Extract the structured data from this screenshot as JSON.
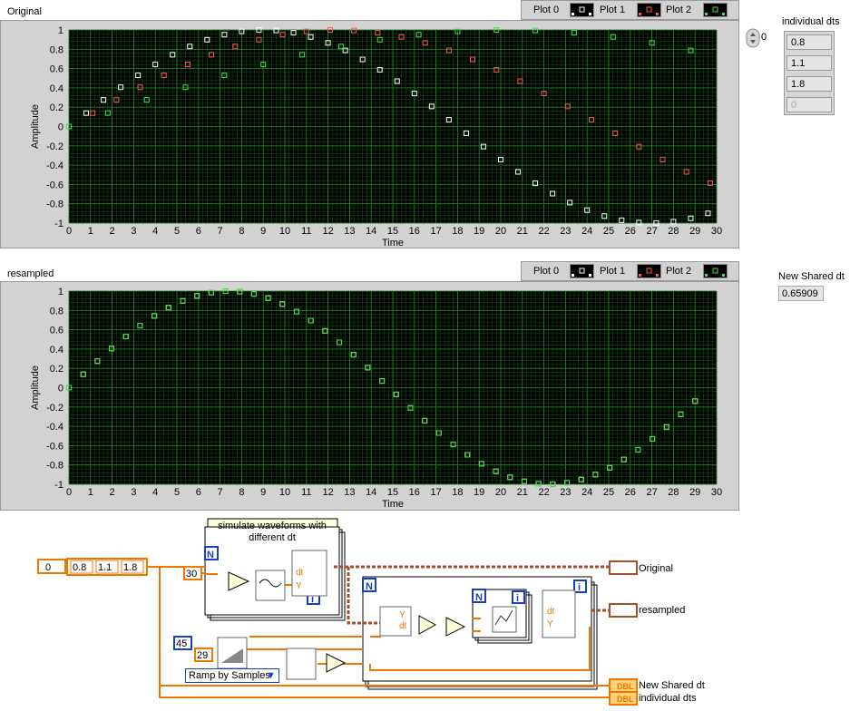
{
  "colors": {
    "plot0": "#ffffff",
    "plot1": "#ff5a4a",
    "plot2": "#3fe04f",
    "grid_major": "#1f8a1f",
    "grid_minor": "#0e4a0e",
    "plot_bg": "#000000",
    "wire_orange": "#f07800",
    "wire_brown": "#a0522d",
    "node_blue": "#1a3fbf"
  },
  "graph_original": {
    "title": "Original",
    "legend": [
      "Plot 0",
      "Plot 1",
      "Plot 2"
    ],
    "xlabel": "Time",
    "ylabel": "Amplitude",
    "xticks": [
      "0",
      "1",
      "2",
      "3",
      "4",
      "5",
      "6",
      "7",
      "8",
      "9",
      "10",
      "11",
      "12",
      "13",
      "14",
      "15",
      "16",
      "17",
      "18",
      "19",
      "20",
      "21",
      "22",
      "23",
      "24",
      "25",
      "26",
      "27",
      "28",
      "29",
      "30"
    ],
    "yticks": [
      "1",
      "0.8",
      "0.6",
      "0.4",
      "0.2",
      "0",
      "-0.2",
      "-0.4",
      "-0.6",
      "-0.8",
      "-1"
    ]
  },
  "graph_resampled": {
    "title": "resampled",
    "legend": [
      "Plot 0",
      "Plot 1",
      "Plot 2"
    ],
    "xlabel": "Time",
    "ylabel": "Amplitude",
    "xticks": [
      "0",
      "1",
      "2",
      "3",
      "4",
      "5",
      "6",
      "7",
      "8",
      "9",
      "10",
      "11",
      "12",
      "13",
      "14",
      "15",
      "16",
      "17",
      "18",
      "19",
      "20",
      "21",
      "22",
      "23",
      "24",
      "25",
      "26",
      "27",
      "28",
      "29",
      "30"
    ],
    "yticks": [
      "1",
      "0.8",
      "0.6",
      "0.4",
      "0.2",
      "0",
      "-0.2",
      "-0.4",
      "-0.6",
      "-0.8",
      "-1"
    ]
  },
  "chart_data": [
    {
      "type": "scatter",
      "title": "Original",
      "xlabel": "Time",
      "ylabel": "Amplitude",
      "xlim": [
        0,
        30
      ],
      "ylim": [
        -1,
        1
      ],
      "grid": true,
      "legend_position": "top-right",
      "series": [
        {
          "name": "Plot 0",
          "dt": 0.8,
          "samples": 38,
          "periods": 45
        },
        {
          "name": "Plot 1",
          "dt": 1.1,
          "samples": 38,
          "periods": 45
        },
        {
          "name": "Plot 2",
          "dt": 1.8,
          "samples": 17,
          "periods": 45
        }
      ]
    },
    {
      "type": "scatter",
      "title": "resampled",
      "xlabel": "Time",
      "ylabel": "Amplitude",
      "xlim": [
        0,
        30
      ],
      "ylim": [
        -1,
        1
      ],
      "grid": true,
      "legend_position": "top-right",
      "series": [
        {
          "name": "Plot 0",
          "dt": 0.65909,
          "samples": 45,
          "periods": 45
        },
        {
          "name": "Plot 1",
          "dt": 0.65909,
          "samples": 45,
          "periods": 45
        },
        {
          "name": "Plot 2",
          "dt": 0.65909,
          "samples": 45,
          "periods": 45
        }
      ]
    }
  ],
  "individual_dts": {
    "label": "individual dts",
    "index": "0",
    "values": [
      "0.8",
      "1.1",
      "1.8",
      "0"
    ]
  },
  "new_shared_dt": {
    "label": "New Shared dt",
    "value": "0.65909"
  },
  "diagram": {
    "loop_comment": "simulate waveforms with different dt",
    "index_const": "0",
    "array_consts": [
      "0.8",
      "1.1",
      "1.8"
    ],
    "const_30": "30",
    "const_45": "45",
    "const_29": "29",
    "n_label": "N",
    "i_label": "i",
    "ramp_mode": "Ramp by Samples",
    "dt_label": "dt",
    "y_label": "Y",
    "out_original": "Original",
    "out_resampled": "resampled",
    "out_new_shared_dt": "New Shared dt",
    "out_individual_dts": "individual dts",
    "dbl": "DBL"
  }
}
